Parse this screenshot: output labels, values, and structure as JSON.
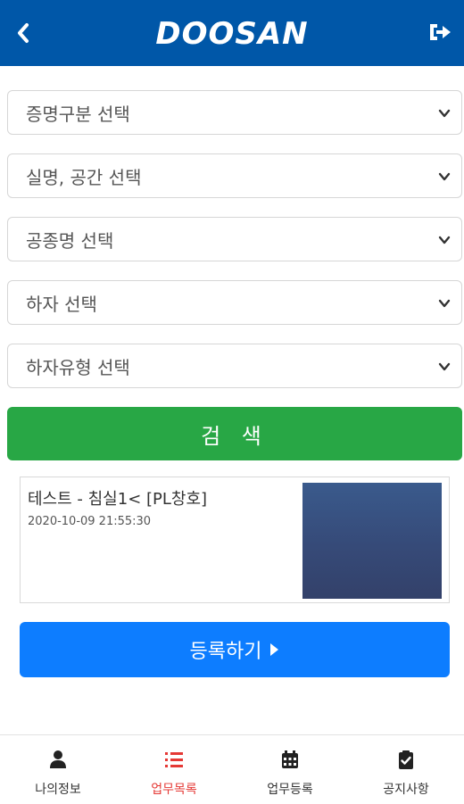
{
  "header": {
    "logo": "DOOSAN",
    "back_icon": "chevron-left-icon",
    "logout_icon": "sign-out-icon"
  },
  "filters": [
    {
      "label": "증명구분 선택"
    },
    {
      "label": "실명, 공간 선택"
    },
    {
      "label": "공종명 선택"
    },
    {
      "label": "하자 선택"
    },
    {
      "label": "하자유형 선택"
    }
  ],
  "search": {
    "label": "검 색"
  },
  "results": [
    {
      "title": "테스트 - 침실1< [PL창호]",
      "datetime": "2020-10-09 21:55:30"
    }
  ],
  "register": {
    "label": "등록하기"
  },
  "nav": [
    {
      "label": "나의정보",
      "icon": "user-icon"
    },
    {
      "label": "업무목록",
      "icon": "list-icon",
      "active": true
    },
    {
      "label": "업무등록",
      "icon": "calendar-icon"
    },
    {
      "label": "공지사항",
      "icon": "clipboard-check-icon"
    }
  ],
  "colors": {
    "header": "#0057a8",
    "search": "#28a745",
    "register": "#0d7dff",
    "active_nav": "#e53935"
  }
}
